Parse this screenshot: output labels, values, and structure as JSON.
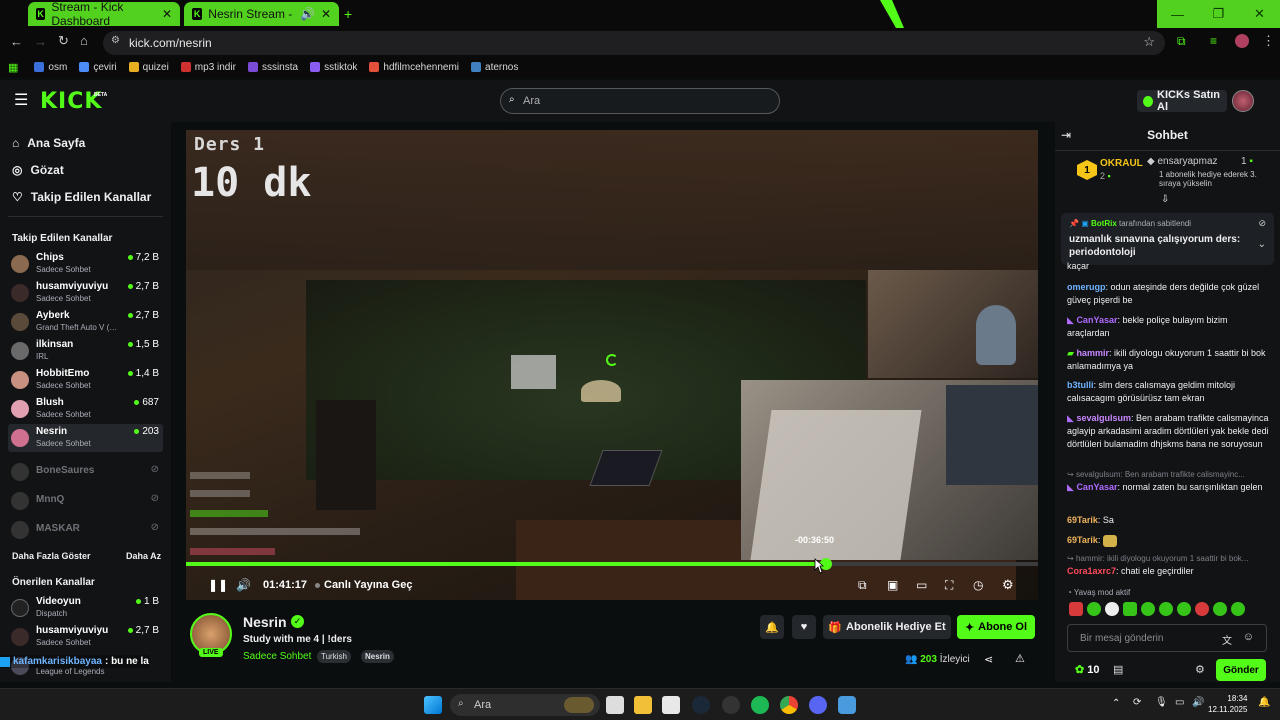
{
  "browser": {
    "tabs": [
      {
        "title": "Stream - Kick Dashboard"
      },
      {
        "title": "Nesrin Stream - Watch Live"
      }
    ],
    "url": "kick.com/nesrin",
    "bookmarks": [
      "osm",
      "çeviri",
      "quizei",
      "mp3 indir",
      "sssinsta",
      "sstiktok",
      "hdfilmcehennemi",
      "aternos"
    ]
  },
  "header": {
    "logo": "KICK",
    "logo_badge": "BETA",
    "search_placeholder": "Ara",
    "kicks_button": "KICKs Satın Al"
  },
  "sidebar": {
    "nav": [
      "Ana Sayfa",
      "Gözat",
      "Takip Edilen Kanallar"
    ],
    "followed_title": "Takip Edilen Kanallar",
    "followed": [
      {
        "name": "Chips",
        "sub": "Sadece Sohbet",
        "viewers": "7,2 B"
      },
      {
        "name": "husamviyuviyu",
        "sub": "Sadece Sohbet",
        "viewers": "2,7 B"
      },
      {
        "name": "Ayberk",
        "sub": "Grand Theft Auto V (…",
        "viewers": "2,7 B"
      },
      {
        "name": "ilkinsan",
        "sub": "IRL",
        "viewers": "1,5 B"
      },
      {
        "name": "HobbitEmo",
        "sub": "Sadece Sohbet",
        "viewers": "1,4 B"
      },
      {
        "name": "Blush",
        "sub": "Sadece Sohbet",
        "viewers": "687"
      },
      {
        "name": "Nesrin",
        "sub": "Sadece Sohbet",
        "viewers": "203"
      }
    ],
    "offline": [
      "BoneSaures",
      "MnnQ",
      "MASKAR"
    ],
    "show_more": "Daha Fazla Göster",
    "show_less": "Daha Az",
    "recommended_title": "Önerilen Kanallar",
    "recommended": [
      {
        "name": "Videoyun",
        "sub": "Dispatch",
        "viewers": "1 B"
      },
      {
        "name": "husamviyuviyu",
        "sub": "Sadece Sohbet",
        "viewers": "2,7 B"
      },
      {
        "name": "",
        "sub": "League of Legends",
        "viewers": ""
      }
    ]
  },
  "video": {
    "overlay_line1": "Ders 1",
    "overlay_line2": "10 dk",
    "progress": 0.751,
    "hover_time": "-00:36:50",
    "elapsed": "01:41:17",
    "go_live": "Canlı Yayına Geç"
  },
  "streamer": {
    "name": "Nesrin",
    "live_badge": "LIVE",
    "title": "Study with me 4 | !ders",
    "category": "Sadece Sohbet",
    "tags": [
      "Turkish",
      "Nesrin"
    ],
    "gift_button": "Abonelik Hediye Et",
    "subscribe_button": "Abone Ol",
    "viewer_count": "203",
    "viewer_label": "İzleyici"
  },
  "overlay_bottom_left": {
    "user": "kafamkarisikbayaa",
    "text": ": bu ne la"
  },
  "chat": {
    "title": "Sohbet",
    "leaderboard": {
      "rank": "1",
      "top_user": "OKRAUL",
      "top_count": "2",
      "gift_user": "ensaryapmaz",
      "gift_count": "1",
      "gift_note": "1 abonelik hediye ederek 3. sıraya yükselin"
    },
    "pinned_by_user": "BotRix",
    "pinned_by_text": "tarafından sabitlendi",
    "pinned_message": "uzmanlık sınavına çalışıyorum ders: periodontoloji",
    "truncated_top": "kaçar",
    "messages": [
      {
        "user": "omerugp",
        "color": "#6fb4ff",
        "text": ": odun ateşinde ders değilde çok güzel güveç pişerdi be"
      },
      {
        "user": "CanYasar",
        "color": "#b06bff",
        "text": ": bekle poliçe bulayım bizim araçlardan"
      },
      {
        "user": "hammir",
        "color": "#c987ff",
        "text": ": ikili diyologu okuyorum 1 saattir bi bok anlamadımya ya"
      },
      {
        "user": "b3tulli",
        "color": "#6fb4ff",
        "text": ": slm ders calısmaya geldim mitoloji calısacagım görüsürüsz tam ekran"
      },
      {
        "user": "sevalgulsum",
        "color": "#c987ff",
        "text": ": Ben arabam trafikte calismayinca aglayip arkadasimi aradim dörtlüleri yak bekle dedi dörtlüleri bulamadim dhjskms bana ne soruyosun"
      },
      {
        "user": "CanYasar",
        "color": "#b06bff",
        "text": ": normal zaten bu sarışınlıktan gelen"
      },
      {
        "user": "69Tarik",
        "color": "#f0b35a",
        "text": ": Sa"
      },
      {
        "user": "69Tarik",
        "color": "#f0b35a",
        "text": ":"
      },
      {
        "user": "Cora1axrc7",
        "color": "#ff4a5a",
        "text": ": chati ele geçirdiler"
      }
    ],
    "reply_1": "sevalgulsum: Ben arabam trafikte calismayinc...",
    "reply_2": "hammir: ikili diyologu okuyorum 1 saattir bi bok...",
    "slow_mode": "Yavaş mod aktif",
    "input_placeholder": "Bir mesaj gönderin",
    "points": "10",
    "send": "Gönder"
  },
  "taskbar": {
    "search": "Ara",
    "time": "18:34",
    "date": "12.11.2025"
  }
}
